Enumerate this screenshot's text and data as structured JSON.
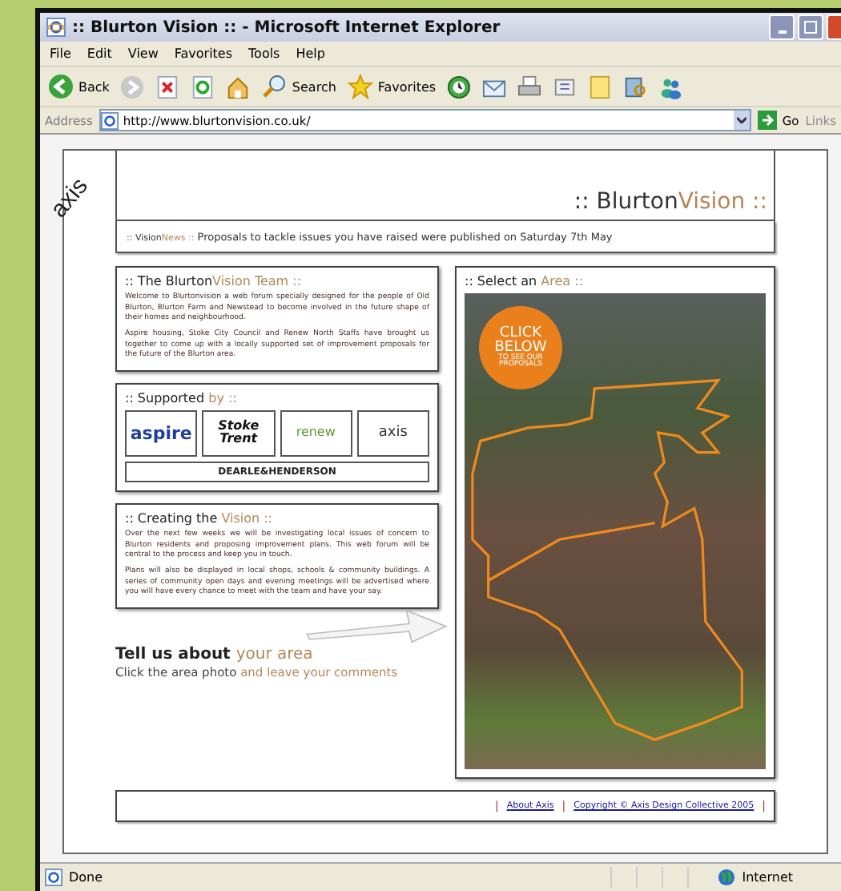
{
  "window": {
    "title": ":: Blurton Vision :: - Microsoft Internet Explorer"
  },
  "menu": [
    "File",
    "Edit",
    "View",
    "Favorites",
    "Tools",
    "Help"
  ],
  "toolbar": {
    "back": "Back",
    "search": "Search",
    "favorites": "Favorites"
  },
  "address": {
    "label": "Address",
    "value": "http://www.blurtonvision.co.uk/",
    "go": "Go",
    "links": "Links"
  },
  "page": {
    "logo": "axis",
    "site_title": {
      "lead": ":: Blurton",
      "accent": "Vision ::"
    },
    "news": {
      "lead": ":: Vision",
      "accent": "News ::",
      "text": "Proposals to tackle issues you have raised were published on Saturday 7th May"
    },
    "team": {
      "heading": {
        "lead": ":: The Blurton",
        "accent": "Vision Team ::"
      },
      "paragraphs": [
        "Welcome to Blurtonvision a web forum specially designed for the people of Old Blurton, Blurton Farm and Newstead to become involved in the future shape of their homes and neighbourhood.",
        "Aspire housing, Stoke City Council and Renew North Staffs have brought us together to come up with a locally supported set of improvement proposals for the future of the Blurton area."
      ]
    },
    "supported": {
      "heading": {
        "lead": ":: Supported",
        "accent": "by ::"
      },
      "logos": [
        {
          "kind": "aspire",
          "text": "aspire"
        },
        {
          "kind": "stoke",
          "text": "Stoke Trent"
        },
        {
          "kind": "renew",
          "text": "renew"
        },
        {
          "kind": "axis",
          "text": "axis"
        }
      ],
      "wide_logo": "DEARLE&HENDERSON"
    },
    "creating": {
      "heading": {
        "lead": ":: Creating the",
        "accent": "Vision ::"
      },
      "paragraphs": [
        "Over the next few weeks we will be investigating local issues of concern to Blurton residents and proposing improvement plans. This web forum will be central to the process and keep you in touch.",
        "Plans will also be displayed in local shops, schools & community buildings. A series of community open days and evening meetings will be advertised where you will have every chance to meet with the team and have your say."
      ]
    },
    "tell": {
      "heading": {
        "lead": "Tell us about",
        "accent": "your area"
      },
      "sub": {
        "lead": "Click the area photo",
        "accent": "and leave your comments"
      }
    },
    "area": {
      "heading": {
        "lead": ":: Select an",
        "accent": "Area ::"
      },
      "badge": [
        "CLICK",
        "BELOW",
        "TO SEE OUR",
        "PROPOSALS"
      ]
    },
    "footer": [
      {
        "kind": "separator",
        "text": "|"
      },
      {
        "kind": "link",
        "text": "About Axis"
      },
      {
        "kind": "separator",
        "text": "|"
      },
      {
        "kind": "link",
        "text": "Copyright © Axis Design Collective 2005"
      },
      {
        "kind": "separator",
        "text": "|"
      }
    ]
  },
  "status_bar": {
    "text": "Done",
    "zone": "Internet"
  }
}
